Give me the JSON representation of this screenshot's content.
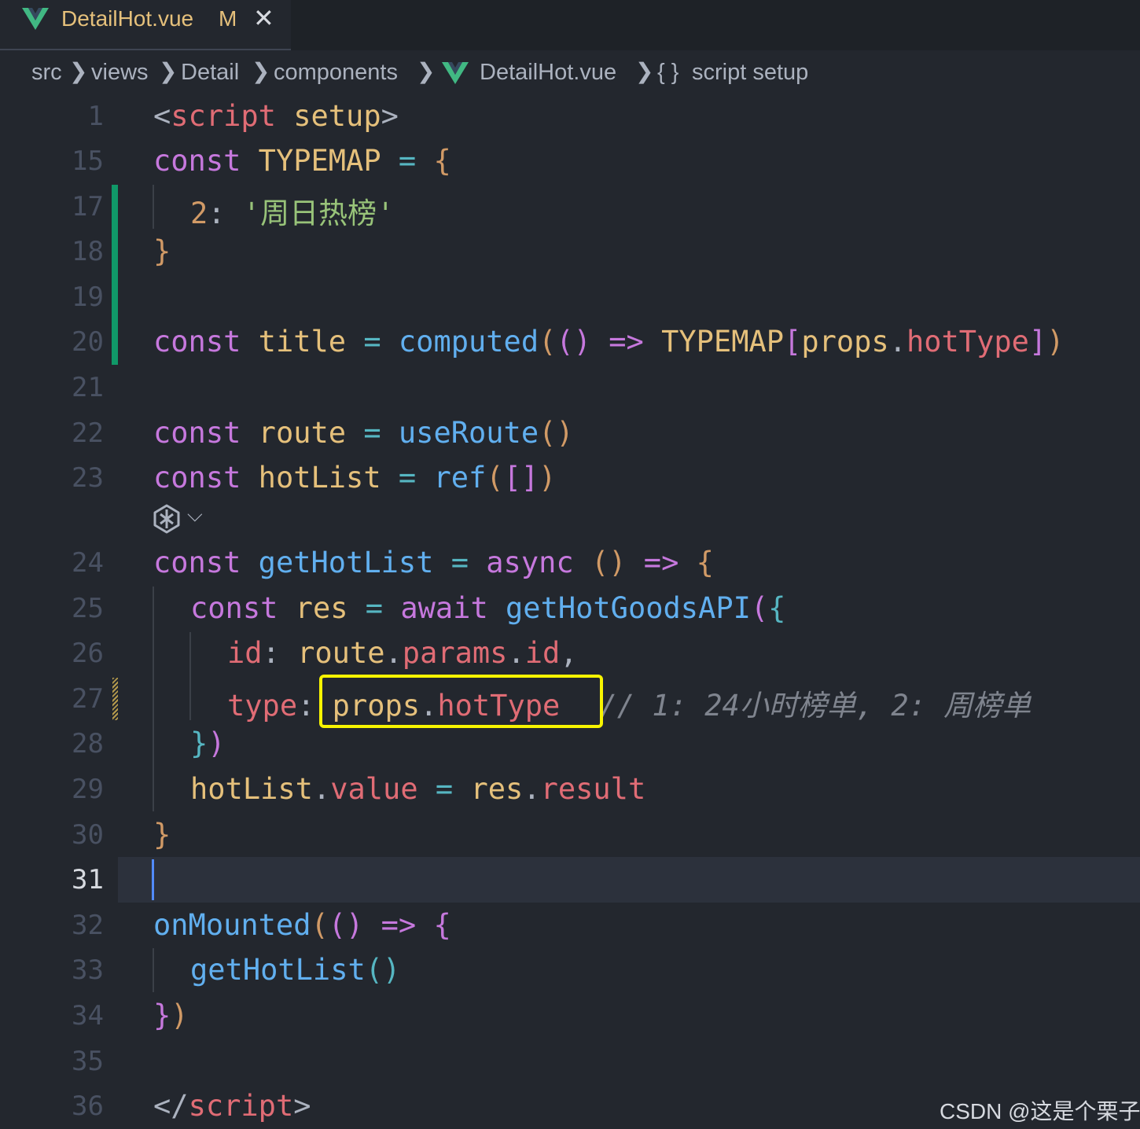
{
  "tab": {
    "name": "DetailHot.vue",
    "status": "M",
    "close": "✕"
  },
  "breadcrumb": {
    "items": [
      "src",
      "views",
      "Detail",
      "components",
      "DetailHot.vue",
      "script setup"
    ],
    "symbol_glyph": "{ }",
    "separator": "❯"
  },
  "editor": {
    "language": "vue",
    "active_line": "31",
    "line_numbers": [
      "1",
      "15",
      "17",
      "18",
      "19",
      "20",
      "21",
      "22",
      "23",
      "24",
      "25",
      "26",
      "27",
      "28",
      "29",
      "30",
      "31",
      "32",
      "33",
      "34",
      "35",
      "36"
    ],
    "lines": {
      "l1": [
        "<",
        "script",
        " ",
        "setup",
        ">"
      ],
      "l15": [
        "const",
        " ",
        "TYPEMAP",
        " ",
        "=",
        " ",
        "{"
      ],
      "l17": [
        "2",
        ":",
        " ",
        "'周日热榜'"
      ],
      "l18": [
        "}"
      ],
      "l20": [
        "const",
        " ",
        "title",
        " ",
        "=",
        " ",
        "computed",
        "(",
        "()",
        " ",
        "=>",
        " ",
        "TYPEMAP",
        "[",
        "props",
        ".",
        "hotType",
        "]",
        ")"
      ],
      "l22": [
        "const",
        " ",
        "route",
        " ",
        "=",
        " ",
        "useRoute",
        "()"
      ],
      "l23": [
        "const",
        " ",
        "hotList",
        " ",
        "=",
        " ",
        "ref",
        "(",
        "[]",
        ")"
      ],
      "l24": [
        "const",
        " ",
        "getHotList",
        " ",
        "=",
        " ",
        "async",
        " ",
        "()",
        " ",
        "=>",
        " ",
        "{"
      ],
      "l25": [
        "const",
        " ",
        "res",
        " ",
        "=",
        " ",
        "await",
        " ",
        "getHotGoodsAPI",
        "(",
        "{"
      ],
      "l26": [
        "id",
        ":",
        " ",
        "route",
        ".",
        "params",
        ".",
        "id",
        ","
      ],
      "l27": [
        "type",
        ":",
        " ",
        "props",
        ".",
        "hotType",
        " ",
        "// 1: 24小时榜单, 2: 周榜单"
      ],
      "l28": [
        "}",
        ")"
      ],
      "l29": [
        "hotList",
        ".",
        "value",
        " ",
        "=",
        " ",
        "res",
        ".",
        "result"
      ],
      "l30": [
        "}"
      ],
      "l32": [
        "onMounted",
        "(",
        "()",
        " ",
        "=>",
        " ",
        "{"
      ],
      "l33": [
        "getHotList",
        "()"
      ],
      "l34": [
        "}",
        ")"
      ],
      "l36": [
        "</",
        "script",
        ">"
      ]
    }
  },
  "codelens": {
    "icon": "ai-sparkle-icon",
    "chevron": "⌵"
  },
  "highlight_box": {
    "color": "#f7f400",
    "target": "props.hotType"
  },
  "watermark": "CSDN @这是个栗子",
  "colors": {
    "background": "#23272e",
    "tabbar": "#1e2227",
    "keyword": "#c678dd",
    "function": "#61afef",
    "variable": "#e5c07b",
    "property": "#e06c75",
    "string": "#98c379",
    "comment": "#7f848e",
    "git_added": "#109868",
    "vue_green": "#41b883"
  }
}
